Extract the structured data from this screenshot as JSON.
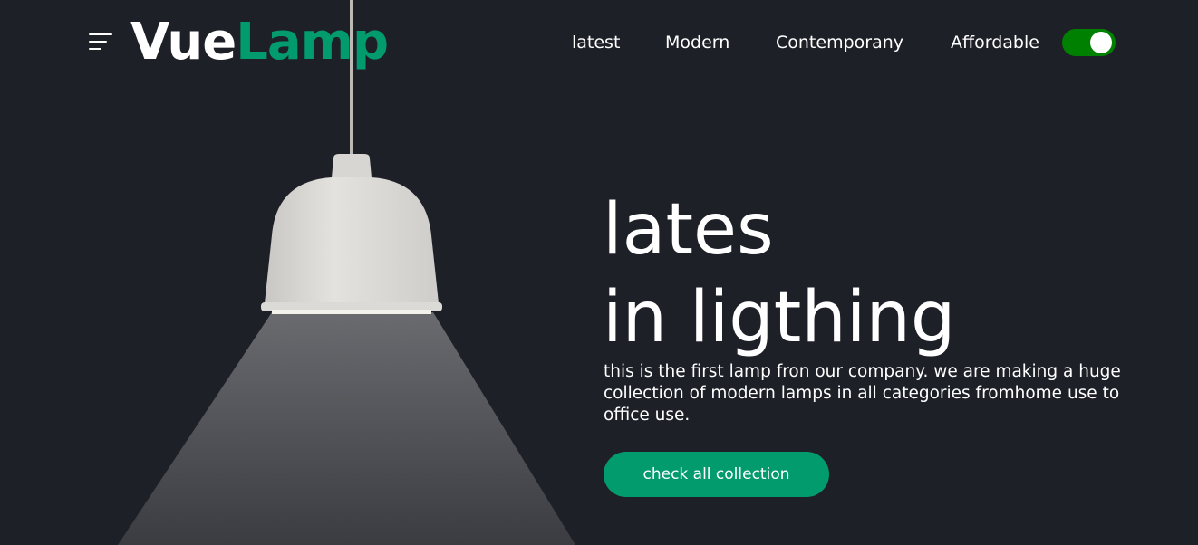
{
  "brand": {
    "part1": "Vue",
    "part2": "Lamp",
    "accent": "#019b6e"
  },
  "nav": {
    "items": [
      "latest",
      "Modern",
      "Contemporany",
      "Affordable"
    ],
    "toggle_on": true
  },
  "hero": {
    "line1": "lates",
    "line2": "in ligthing",
    "description": "this is the first lamp fron our company. we are making a huge collection of modern lamps in all categories fromhome use to office use.",
    "button": "check all collection"
  }
}
